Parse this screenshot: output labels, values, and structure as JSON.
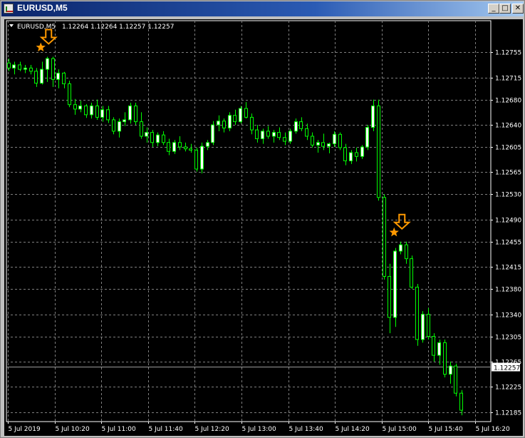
{
  "window": {
    "title": "EURUSD,M5",
    "buttons": {
      "minimize": "_",
      "maximize": "□",
      "close": "✕"
    }
  },
  "chart_header": {
    "symbol": "EURUSD,M5",
    "ohlc": "1.12264 1.12264 1.12257 1.12257"
  },
  "colors": {
    "background": "#000000",
    "grid": "#7f7f7f",
    "bull_candle": "#ffffff",
    "bear_candle": "#000000",
    "candle_outline": "#00ff00",
    "arrow": "#ff9900",
    "text": "#ffffff"
  },
  "chart_data": {
    "type": "candlestick",
    "title": "",
    "grid": true,
    "y_ticks": [
      "1.12755",
      "1.12715",
      "1.12680",
      "1.12640",
      "1.12605",
      "1.12565",
      "1.12530",
      "1.12490",
      "1.12455",
      "1.12415",
      "1.12380",
      "1.12340",
      "1.12305",
      "1.12265",
      "1.12225",
      "1.12185"
    ],
    "x_ticks": [
      "5 Jul 2019",
      "5 Jul 10:20",
      "5 Jul 11:00",
      "5 Jul 11:40",
      "5 Jul 12:20",
      "5 Jul 13:00",
      "5 Jul 13:40",
      "5 Jul 14:20",
      "5 Jul 15:00",
      "5 Jul 15:40",
      "5 Jul 16:20"
    ],
    "y_range": [
      1.1217,
      1.12805
    ],
    "current_price": "1.12257",
    "candles_ohlc": [
      [
        1.12738,
        1.12745,
        1.12725,
        1.1273
      ],
      [
        1.1273,
        1.1274,
        1.1272,
        1.12735
      ],
      [
        1.12735,
        1.1274,
        1.12725,
        1.12728
      ],
      [
        1.12728,
        1.12735,
        1.12722,
        1.1273
      ],
      [
        1.1273,
        1.12735,
        1.1272,
        1.12725
      ],
      [
        1.12725,
        1.1273,
        1.127,
        1.12706
      ],
      [
        1.12706,
        1.1274,
        1.12704,
        1.12728
      ],
      [
        1.12728,
        1.12748,
        1.12708,
        1.12745
      ],
      [
        1.12745,
        1.12748,
        1.127,
        1.12712
      ],
      [
        1.12712,
        1.12728,
        1.12698,
        1.12722
      ],
      [
        1.12722,
        1.12724,
        1.12698,
        1.12705
      ],
      [
        1.12705,
        1.1271,
        1.12668,
        1.12672
      ],
      [
        1.12672,
        1.12681,
        1.12656,
        1.12665
      ],
      [
        1.12665,
        1.12678,
        1.1266,
        1.1267
      ],
      [
        1.1267,
        1.12673,
        1.12651,
        1.12656
      ],
      [
        1.12656,
        1.12675,
        1.1265,
        1.1267
      ],
      [
        1.1267,
        1.1268,
        1.12648,
        1.12652
      ],
      [
        1.12652,
        1.1267,
        1.12645,
        1.12664
      ],
      [
        1.12664,
        1.1267,
        1.12643,
        1.12648
      ],
      [
        1.12648,
        1.12652,
        1.12625,
        1.1263
      ],
      [
        1.1263,
        1.1265,
        1.1262,
        1.12645
      ],
      [
        1.12645,
        1.1266,
        1.12638,
        1.12648
      ],
      [
        1.12648,
        1.12675,
        1.12642,
        1.1267
      ],
      [
        1.1267,
        1.12675,
        1.1264,
        1.12645
      ],
      [
        1.12645,
        1.1266,
        1.12618,
        1.12622
      ],
      [
        1.12622,
        1.12636,
        1.12612,
        1.12628
      ],
      [
        1.12628,
        1.12632,
        1.12605,
        1.12612
      ],
      [
        1.12612,
        1.12628,
        1.12606,
        1.12624
      ],
      [
        1.12624,
        1.1263,
        1.12608,
        1.12612
      ],
      [
        1.12612,
        1.12618,
        1.12592,
        1.12598
      ],
      [
        1.12598,
        1.12616,
        1.12594,
        1.12612
      ],
      [
        1.12612,
        1.12622,
        1.126,
        1.12605
      ],
      [
        1.12605,
        1.12612,
        1.12598,
        1.12602
      ],
      [
        1.12602,
        1.1261,
        1.12596,
        1.126
      ],
      [
        1.126,
        1.12604,
        1.12566,
        1.1257
      ],
      [
        1.1257,
        1.12612,
        1.12563,
        1.12606
      ],
      [
        1.12606,
        1.12616,
        1.126,
        1.12612
      ],
      [
        1.12612,
        1.12646,
        1.12608,
        1.1264
      ],
      [
        1.1264,
        1.12655,
        1.1263,
        1.12646
      ],
      [
        1.12646,
        1.1265,
        1.12628,
        1.12635
      ],
      [
        1.12635,
        1.1266,
        1.1263,
        1.12655
      ],
      [
        1.12655,
        1.12664,
        1.1264,
        1.12645
      ],
      [
        1.12645,
        1.1267,
        1.12642,
        1.12666
      ],
      [
        1.12666,
        1.12676,
        1.1265,
        1.12652
      ],
      [
        1.12652,
        1.12658,
        1.12625,
        1.12632
      ],
      [
        1.12632,
        1.1264,
        1.12612,
        1.12618
      ],
      [
        1.12618,
        1.12634,
        1.1261,
        1.1263
      ],
      [
        1.1263,
        1.12638,
        1.12618,
        1.12622
      ],
      [
        1.12622,
        1.12632,
        1.12612,
        1.12628
      ],
      [
        1.12628,
        1.12636,
        1.12616,
        1.1262
      ],
      [
        1.1262,
        1.12628,
        1.12608,
        1.12614
      ],
      [
        1.12614,
        1.12634,
        1.1261,
        1.1263
      ],
      [
        1.1263,
        1.1265,
        1.12626,
        1.12645
      ],
      [
        1.12645,
        1.12652,
        1.1263,
        1.12634
      ],
      [
        1.12634,
        1.12642,
        1.12616,
        1.12622
      ],
      [
        1.12622,
        1.12628,
        1.12604,
        1.12608
      ],
      [
        1.12608,
        1.12616,
        1.12596,
        1.12612
      ],
      [
        1.12612,
        1.12626,
        1.126,
        1.12606
      ],
      [
        1.12606,
        1.12612,
        1.12595,
        1.1261
      ],
      [
        1.1261,
        1.1263,
        1.12605,
        1.12625
      ],
      [
        1.12625,
        1.12628,
        1.126,
        1.12604
      ],
      [
        1.12604,
        1.1261,
        1.12576,
        1.12583
      ],
      [
        1.12583,
        1.126,
        1.12578,
        1.12596
      ],
      [
        1.12596,
        1.12604,
        1.12582,
        1.1259
      ],
      [
        1.1259,
        1.12608,
        1.12586,
        1.12605
      ],
      [
        1.12605,
        1.1264,
        1.126,
        1.12636
      ],
      [
        1.12636,
        1.1268,
        1.1263,
        1.1267
      ],
      [
        1.1267,
        1.1268,
        1.1252,
        1.12525
      ],
      [
        1.12525,
        1.1253,
        1.12395,
        1.124
      ],
      [
        1.124,
        1.1242,
        1.1231,
        1.12335
      ],
      [
        1.12335,
        1.12445,
        1.1232,
        1.1244
      ],
      [
        1.1244,
        1.12455,
        1.12435,
        1.1245
      ],
      [
        1.1245,
        1.12455,
        1.1242,
        1.12428
      ],
      [
        1.12428,
        1.12433,
        1.1238,
        1.12383
      ],
      [
        1.12383,
        1.12388,
        1.1229,
        1.123
      ],
      [
        1.123,
        1.12345,
        1.12295,
        1.1234
      ],
      [
        1.1234,
        1.1235,
        1.123,
        1.12305
      ],
      [
        1.12305,
        1.1231,
        1.12265,
        1.12275
      ],
      [
        1.12275,
        1.123,
        1.1226,
        1.12295
      ],
      [
        1.12295,
        1.123,
        1.1224,
        1.12245
      ],
      [
        1.12245,
        1.12265,
        1.1223,
        1.12258
      ],
      [
        1.12258,
        1.12262,
        1.1221,
        1.12215
      ],
      [
        1.12215,
        1.1222,
        1.1218,
        1.12188
      ]
    ],
    "sell_arrows_at_candle": [
      7,
      71
    ]
  }
}
